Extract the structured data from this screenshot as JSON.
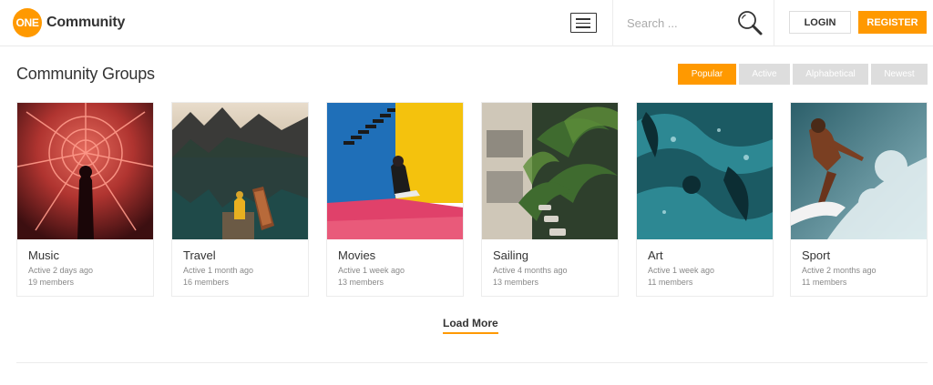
{
  "header": {
    "logo_badge": "ONE",
    "logo_text": "Community",
    "search_placeholder": "Search ...",
    "login_label": "LOGIN",
    "register_label": "REGISTER"
  },
  "section": {
    "title": "Community Groups",
    "filters": [
      "Popular",
      "Active",
      "Alphabetical",
      "Newest"
    ],
    "active_filter": "Popular"
  },
  "groups": [
    {
      "name": "Music",
      "active": "Active 2 days ago",
      "members": "19 members"
    },
    {
      "name": "Travel",
      "active": "Active 1 month ago",
      "members": "16 members"
    },
    {
      "name": "Movies",
      "active": "Active 1 week ago",
      "members": "13 members"
    },
    {
      "name": "Sailing",
      "active": "Active 4 months ago",
      "members": "13 members"
    },
    {
      "name": "Art",
      "active": "Active 1 week ago",
      "members": "11 members"
    },
    {
      "name": "Sport",
      "active": "Active 2 months ago",
      "members": "11 members"
    }
  ],
  "load_more_label": "Load More",
  "colors": {
    "accent": "#ff9900",
    "filter_inactive": "#dddddd"
  },
  "icons": {
    "menu": "hamburger-menu-icon",
    "search": "magnifier-icon"
  }
}
